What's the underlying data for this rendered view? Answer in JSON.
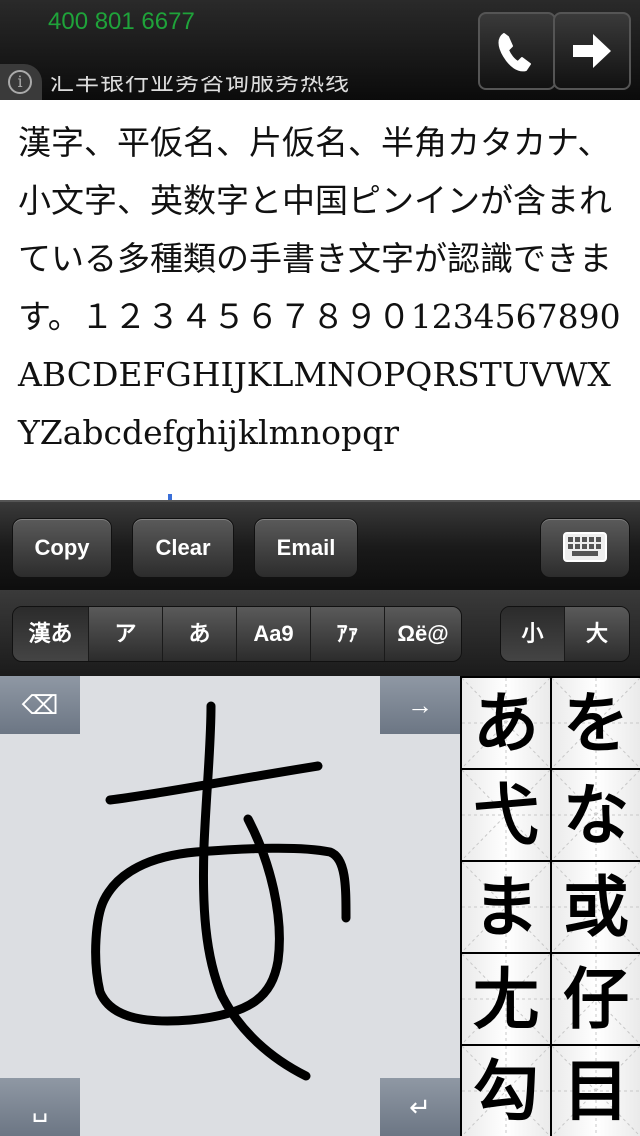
{
  "banner": {
    "phone_number": "400 801 6677",
    "ad_text": "汇丰银行业务咨询服务热线",
    "info_icon": "info-icon",
    "call_icon": "phone-icon",
    "next_icon": "arrow-right-icon"
  },
  "textarea": {
    "content": "漢字、平仮名、片仮名、半角カタカナ、小文字、英数字と中国ピンインが含まれている多種類の手書き文字が認識できます。１２３４５６７８９０1234567890ABCDEFGHIJKLMNOPQRSTUVWXYZabcdefghijklmnopqr"
  },
  "toolbar": {
    "copy_label": "Copy",
    "clear_label": "Clear",
    "email_label": "Email",
    "keyboard_icon": "keyboard-icon"
  },
  "modes": {
    "script": [
      "漢あ",
      "ア",
      "あ",
      "Aa9",
      "ｱｧ",
      "Ωë@"
    ],
    "size": [
      "小",
      "大"
    ],
    "active_script": 0
  },
  "pad": {
    "backspace_icon": "backspace-icon",
    "arrow_icon": "arrow-right-icon",
    "space_icon": "space-icon",
    "return_icon": "return-icon",
    "backspace_glyph": "⌫",
    "arrow_glyph": "→",
    "space_glyph": "␣",
    "return_glyph": "↵"
  },
  "candidates": [
    "あ",
    "を",
    "弋",
    "な",
    "ま",
    "或",
    "尢",
    "仔",
    "勾",
    "目"
  ],
  "colors": {
    "phone_text": "#1fa33a",
    "pad_background": "#dcdee2",
    "stroke": "#000000"
  }
}
